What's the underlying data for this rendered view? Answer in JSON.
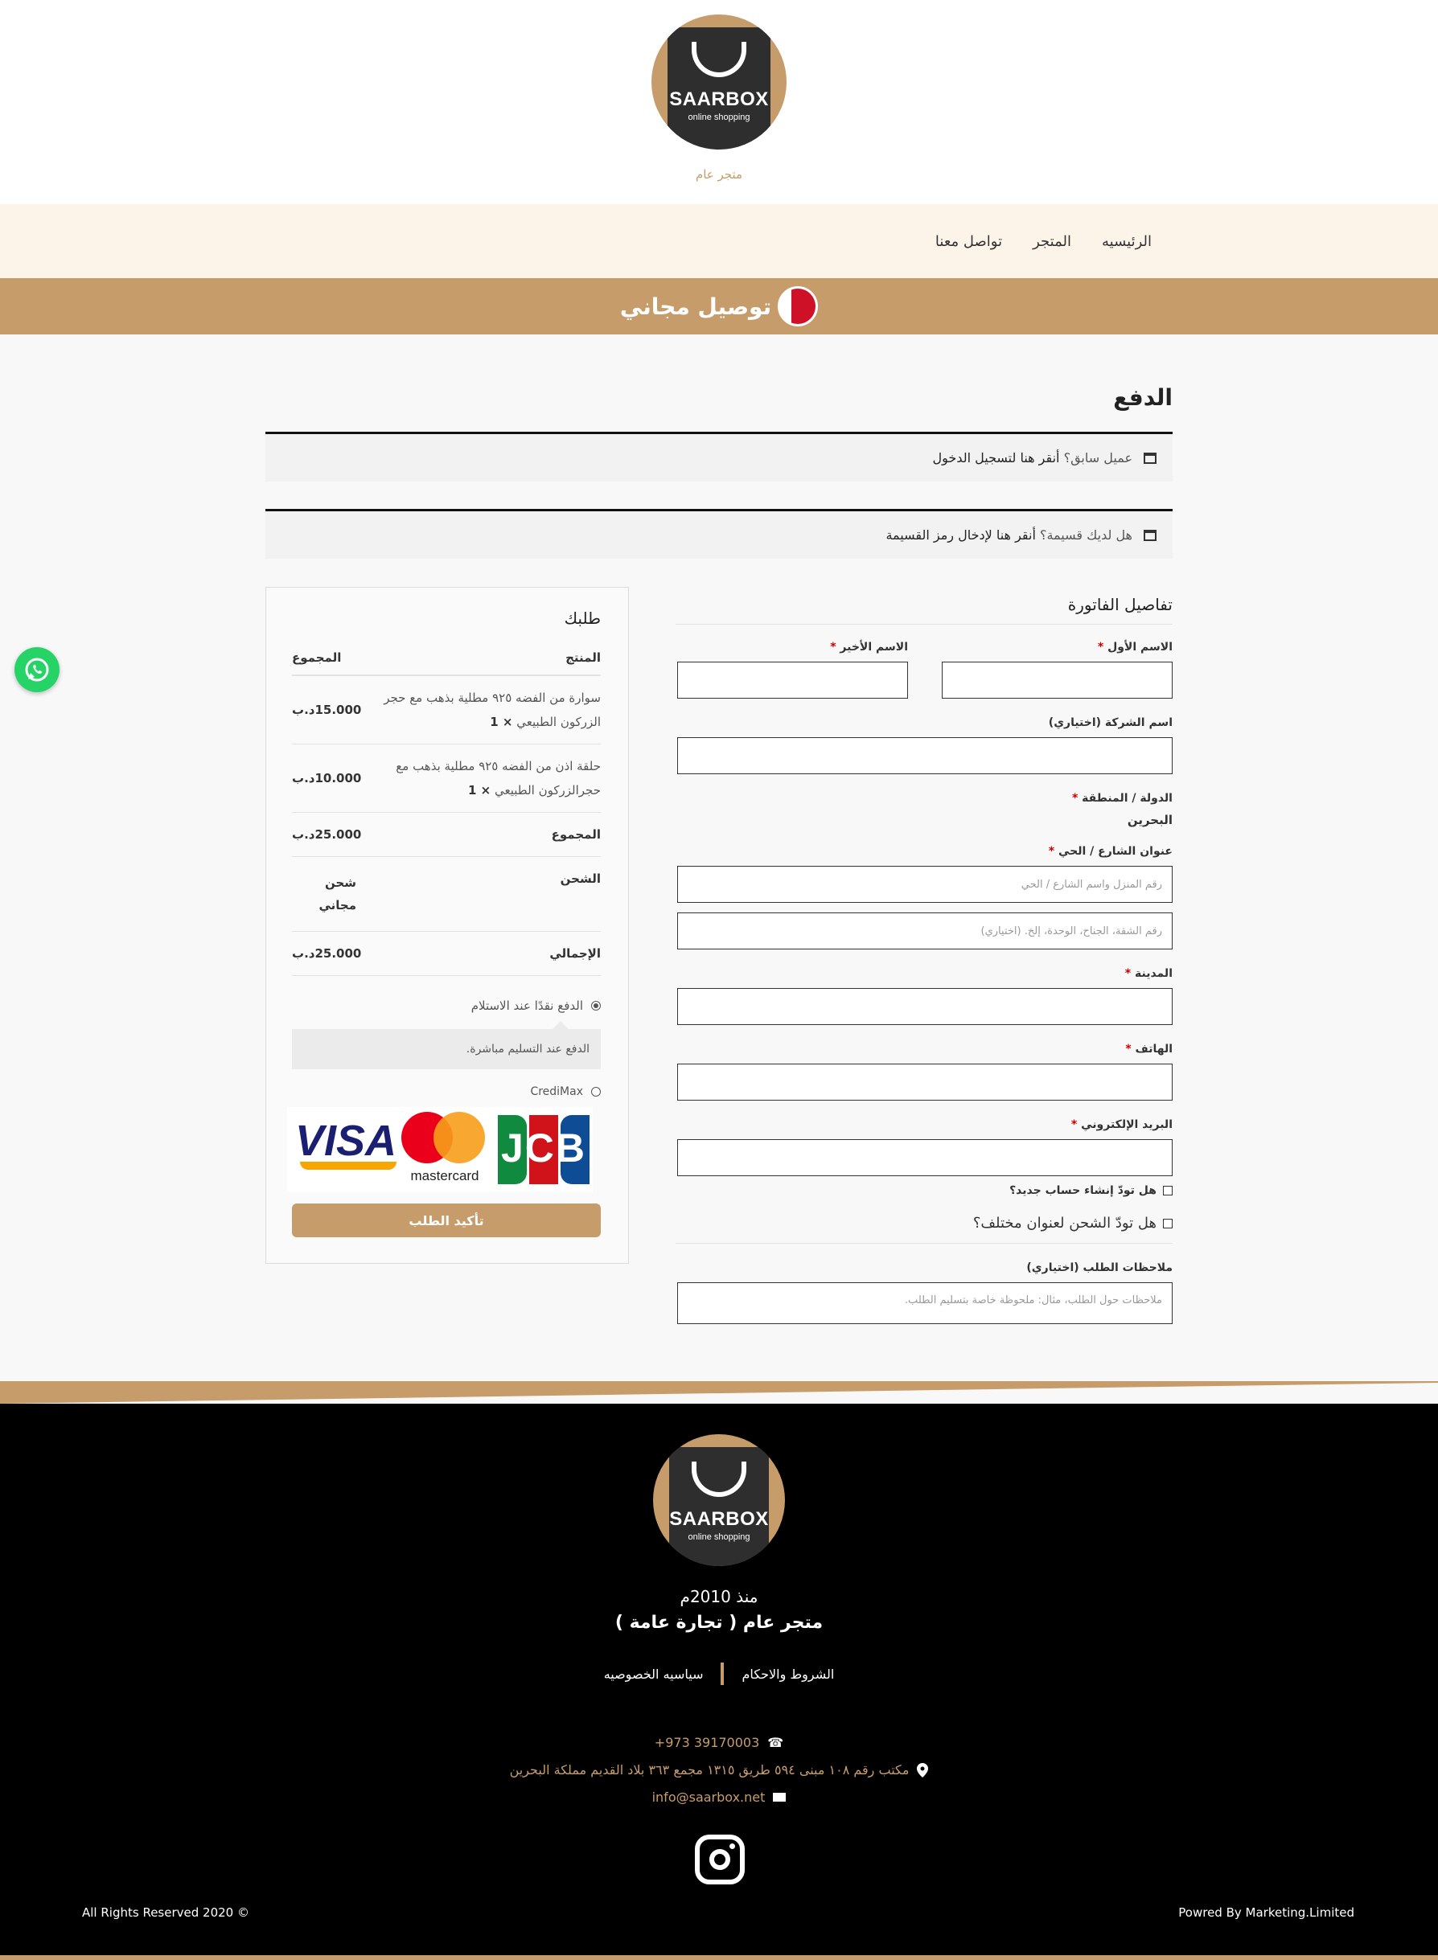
{
  "header": {
    "logo_title": "SAARBOX",
    "logo_subtitle": "online shopping",
    "tagline": "متجر عام"
  },
  "nav": {
    "items": [
      {
        "label": "الرئيسيه"
      },
      {
        "label": "المتجر"
      },
      {
        "label": "تواصل معنا"
      }
    ]
  },
  "banner": {
    "text": "توصيل مجاني"
  },
  "checkout": {
    "title": "الدفع",
    "returning_prompt": "عميل سابق؟",
    "returning_link": "أنقر هنا لتسجيل الدخول",
    "coupon_prompt": "هل لديك قسيمة؟",
    "coupon_link": "أنقر هنا لإدخال رمز القسيمة"
  },
  "billing": {
    "title": "تفاصيل الفاتورة",
    "first_name_label": "الاسم الأول",
    "last_name_label": "الاسم الأخير",
    "company_label": "اسم الشركة (اختياري)",
    "country_label": "الدولة / المنطقة",
    "country_value": "البحرين",
    "street_label": "عنوان الشارع / الحي",
    "street_placeholder": "رقم المنزل واسم الشارع / الحي",
    "street2_placeholder": "رقم الشقة، الجناح، الوحدة، إلخ. (اختياري)",
    "city_label": "المدينة",
    "phone_label": "الهاتف",
    "email_label": "البريد الإلكتروني",
    "create_account_label": "هل تودّ إنشاء حساب جديد؟",
    "ship_different_label": "هل تودّ الشحن لعنوان مختلف؟",
    "notes_label": "ملاحظات الطلب (اختياري)",
    "notes_placeholder": "ملاحظات حول الطلب، مثال: ملحوظة خاصة بتسليم الطلب.",
    "required_mark": "*"
  },
  "order": {
    "title": "طلبك",
    "col_product": "المنتج",
    "col_total": "المجموع",
    "items": [
      {
        "name": "سوارة من الفضه ٩٢٥ مطلية بذهب مع حجر الزركون الطبيعي",
        "qty": "× 1",
        "price": "15.000د.ب"
      },
      {
        "name": "حلقة اذن من الفضه ٩٢٥ مطلية بذهب مع حجرالزركون الطبيعي",
        "qty": "× 1",
        "price": "10.000د.ب"
      }
    ],
    "subtotal_label": "المجموع",
    "subtotal_value": "25.000د.ب",
    "shipping_label": "الشحن",
    "shipping_value": "شحن مجاني",
    "total_label": "الإجمالي",
    "total_value": "25.000د.ب",
    "payment_cod_label": "الدفع نقدًا عند الاستلام",
    "payment_cod_desc": "الدفع عند التسليم مباشرة.",
    "payment_credimax_label": "CrediMax",
    "card_visa": "VISA",
    "card_mastercard": "mastercard",
    "card_jcb": "JCB",
    "place_order": "تأكيد الطلب"
  },
  "footer": {
    "since": "منذ 2010م",
    "company": "متجر عام ( تجارة عامة )",
    "terms": "الشروط والاحكام",
    "privacy": "سياسيه الخصوصيه",
    "phone": "+973 39170003",
    "address": "مكتب رقم ١٠٨ مبنى ٥٩٤ طريق ١٣١٥ مجمع ٣٦٣ بلاد القديم مملكة البحرين",
    "email": "info@saarbox.net",
    "rights": "All Rights Reserved 2020 ©",
    "powered": "Powred By Marketing.Limited"
  },
  "colors": {
    "accent": "#c79c6b",
    "nav_bg": "#fdf4e9",
    "whatsapp": "#25d366"
  }
}
